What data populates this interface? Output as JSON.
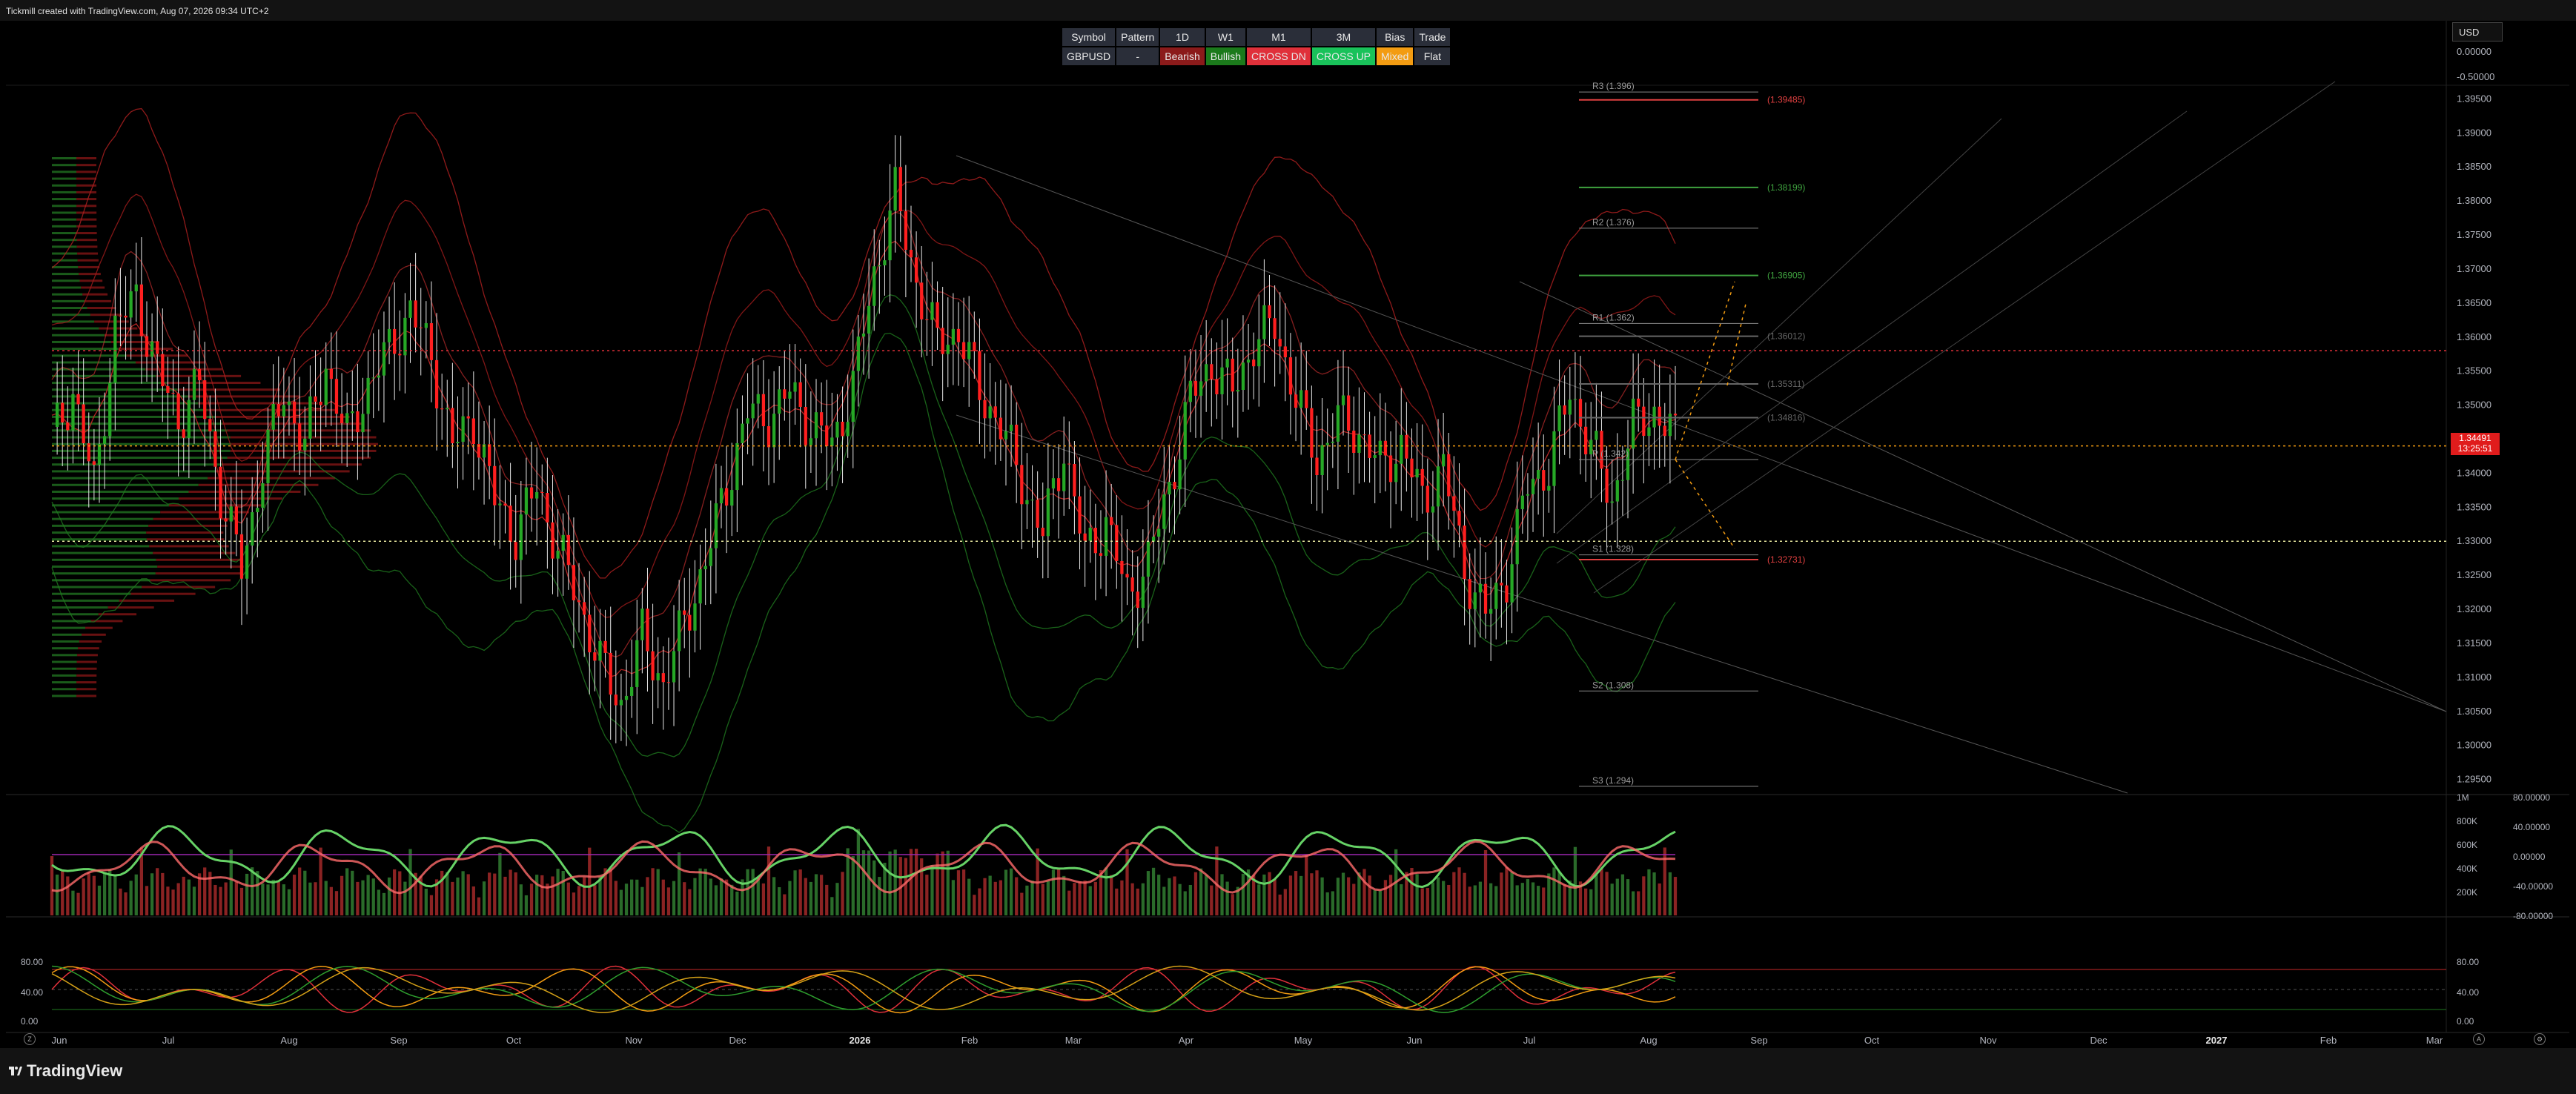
{
  "header": {
    "text": "Tickmill created with TradingView.com, Aug 07, 2026 09:34 UTC+2"
  },
  "currency": "USD",
  "summary_table": {
    "headers": [
      "Symbol",
      "Pattern",
      "1D",
      "W1",
      "M1",
      "3M",
      "Bias",
      "Trade"
    ],
    "row": [
      "GBPUSD",
      "-",
      "Bearish",
      "Bullish",
      "CROSS DN",
      "CROSS UP",
      "Mixed",
      "Flat"
    ],
    "row_colors": [
      "#2a2e39",
      "#2a2e39",
      "#8b1a1a",
      "#1b7a1b",
      "#e0303a",
      "#19c25a",
      "#f39c12",
      "#2a2e39"
    ]
  },
  "price_tag": {
    "price": "1.34491",
    "countdown": "13:25:51"
  },
  "chart_data": [
    {
      "type": "candlestick",
      "name": "GBPUSD",
      "y_ticks": [
        "0.00000",
        "-0.50000",
        "1.39500",
        "1.39000",
        "1.38500",
        "1.38000",
        "1.37500",
        "1.37000",
        "1.36500",
        "1.36000",
        "1.35500",
        "1.35000",
        "1.34500",
        "1.34000",
        "1.33500",
        "1.33000",
        "1.32500",
        "1.32000",
        "1.31500",
        "1.31000",
        "1.30500",
        "1.30000",
        "1.29500"
      ],
      "ylim": [
        1.293,
        1.397
      ],
      "x_ticks": [
        "Jun",
        "Jul",
        "Aug",
        "Sep",
        "Oct",
        "Nov",
        "Dec",
        "2026",
        "Feb",
        "Mar",
        "Apr",
        "May",
        "Jun",
        "Jul",
        "Aug",
        "Sep",
        "Oct",
        "Nov",
        "Dec",
        "2027",
        "Feb",
        "Mar"
      ],
      "close_path": [
        [
          0,
          1.345
        ],
        [
          4,
          1.352
        ],
        [
          8,
          1.338
        ],
        [
          12,
          1.361
        ],
        [
          16,
          1.366
        ],
        [
          20,
          1.355
        ],
        [
          24,
          1.348
        ],
        [
          28,
          1.353
        ],
        [
          32,
          1.337
        ],
        [
          36,
          1.326
        ],
        [
          40,
          1.341
        ],
        [
          44,
          1.352
        ],
        [
          48,
          1.344
        ],
        [
          52,
          1.356
        ],
        [
          56,
          1.345
        ],
        [
          60,
          1.353
        ],
        [
          64,
          1.358
        ],
        [
          68,
          1.364
        ],
        [
          72,
          1.357
        ],
        [
          76,
          1.344
        ],
        [
          80,
          1.348
        ],
        [
          84,
          1.336
        ],
        [
          88,
          1.331
        ],
        [
          92,
          1.338
        ],
        [
          96,
          1.329
        ],
        [
          100,
          1.321
        ],
        [
          104,
          1.312
        ],
        [
          108,
          1.306
        ],
        [
          112,
          1.316
        ],
        [
          116,
          1.309
        ],
        [
          120,
          1.318
        ],
        [
          124,
          1.327
        ],
        [
          128,
          1.338
        ],
        [
          132,
          1.349
        ],
        [
          136,
          1.348
        ],
        [
          140,
          1.352
        ],
        [
          144,
          1.347
        ],
        [
          148,
          1.344
        ],
        [
          152,
          1.353
        ],
        [
          156,
          1.369
        ],
        [
          160,
          1.381
        ],
        [
          164,
          1.368
        ],
        [
          168,
          1.359
        ],
        [
          172,
          1.361
        ],
        [
          176,
          1.352
        ],
        [
          180,
          1.347
        ],
        [
          184,
          1.339
        ],
        [
          188,
          1.331
        ],
        [
          192,
          1.344
        ],
        [
          196,
          1.328
        ],
        [
          200,
          1.333
        ],
        [
          204,
          1.322
        ],
        [
          208,
          1.327
        ],
        [
          212,
          1.338
        ],
        [
          216,
          1.351
        ],
        [
          220,
          1.356
        ],
        [
          224,
          1.352
        ],
        [
          228,
          1.359
        ],
        [
          232,
          1.362
        ],
        [
          236,
          1.351
        ],
        [
          240,
          1.342
        ],
        [
          244,
          1.348
        ],
        [
          248,
          1.346
        ],
        [
          252,
          1.341
        ],
        [
          256,
          1.344
        ],
        [
          260,
          1.336
        ],
        [
          264,
          1.341
        ],
        [
          268,
          1.326
        ],
        [
          272,
          1.319
        ],
        [
          276,
          1.325
        ],
        [
          280,
          1.338
        ],
        [
          284,
          1.341
        ],
        [
          288,
          1.352
        ],
        [
          292,
          1.344
        ],
        [
          296,
          1.336
        ],
        [
          300,
          1.347
        ],
        [
          304,
          1.349
        ],
        [
          308,
          1.345
        ]
      ],
      "volume_profile": "left",
      "pivot_levels": [
        {
          "label": "R3 (1.396)",
          "value": 1.396
        },
        {
          "label": "R2 (1.376)",
          "value": 1.376
        },
        {
          "label": "R1 (1.362)",
          "value": 1.362
        },
        {
          "label": "P (1.342)",
          "value": 1.342
        },
        {
          "label": "S1 (1.328)",
          "value": 1.328
        },
        {
          "label": "S2 (1.308)",
          "value": 1.308
        },
        {
          "label": "S3 (1.294)",
          "value": 1.294
        }
      ],
      "level_labels": [
        {
          "label": "(1.39485)",
          "value": 1.39485,
          "color": "#e04040"
        },
        {
          "label": "(1.38199)",
          "value": 1.38199,
          "color": "#3fa33f"
        },
        {
          "label": "(1.36905)",
          "value": 1.36905,
          "color": "#3fa33f"
        },
        {
          "label": "(1.36012)",
          "value": 1.36012,
          "color": "#666666"
        },
        {
          "label": "(1.35311)",
          "value": 1.35311,
          "color": "#666666"
        },
        {
          "label": "(1.34816)",
          "value": 1.34816,
          "color": "#666666"
        },
        {
          "label": "(1.32731)",
          "value": 1.32731,
          "color": "#e04040"
        }
      ],
      "dotted_levels": [
        1.358,
        1.344,
        1.33
      ]
    },
    {
      "type": "bar",
      "name": "volume",
      "y_ticks_left": [
        "1M",
        "800K",
        "600K",
        "400K",
        "200K"
      ],
      "y_ticks_right": [
        "80.00000",
        "40.00000",
        "0.00000",
        "-40.00000",
        "-80.00000"
      ],
      "note": "volume bars with oscillator overlay"
    },
    {
      "type": "line",
      "name": "stochastic",
      "y_ticks": [
        "80.00",
        "40.00",
        "0.00"
      ],
      "y_ticks_right": [
        "80.00",
        "40.00",
        "0.00"
      ],
      "ylim": [
        0,
        100
      ]
    }
  ],
  "footer": {
    "brand": "TradingView"
  }
}
